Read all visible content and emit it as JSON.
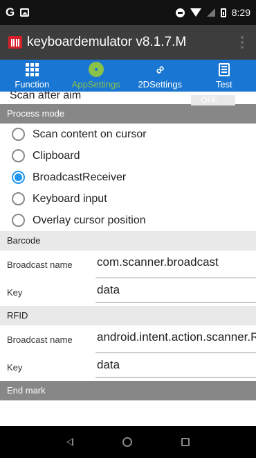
{
  "status_bar": {
    "carrier_mark": "G",
    "time": "8:29"
  },
  "app_bar": {
    "title": "keyboardemulator v8.1.7.M"
  },
  "tabs": [
    {
      "label": "Function",
      "icon": "grid-icon"
    },
    {
      "label": "AppSettings",
      "icon": "gear-icon",
      "active": true
    },
    {
      "label": "2DSettings",
      "icon": "link-icon"
    },
    {
      "label": "Test",
      "icon": "calculator-icon"
    }
  ],
  "scan_after_aim": {
    "label": "Scan after aim",
    "toggle": "OFF"
  },
  "process_mode": {
    "header": "Process mode",
    "options": [
      {
        "label": "Scan content on cursor",
        "checked": false
      },
      {
        "label": "Clipboard",
        "checked": false
      },
      {
        "label": "BroadcastReceiver",
        "checked": true
      },
      {
        "label": "Keyboard input",
        "checked": false
      },
      {
        "label": "Overlay cursor position",
        "checked": false
      }
    ]
  },
  "barcode": {
    "header": "Barcode",
    "broadcast_label": "Broadcast name",
    "broadcast_value": "com.scanner.broadcast",
    "key_label": "Key",
    "key_value": "data"
  },
  "rfid": {
    "header": "RFID",
    "broadcast_label": "Broadcast name",
    "broadcast_value": "android.intent.action.scanner.RFID",
    "key_label": "Key",
    "key_value": "data"
  },
  "end_mark": {
    "header": "End mark"
  },
  "colors": {
    "tab_bar": "#1976d2",
    "active_tab": "#8bc34a",
    "radio_checked": "#2196f3",
    "app_bar": "#3d3d3d"
  }
}
